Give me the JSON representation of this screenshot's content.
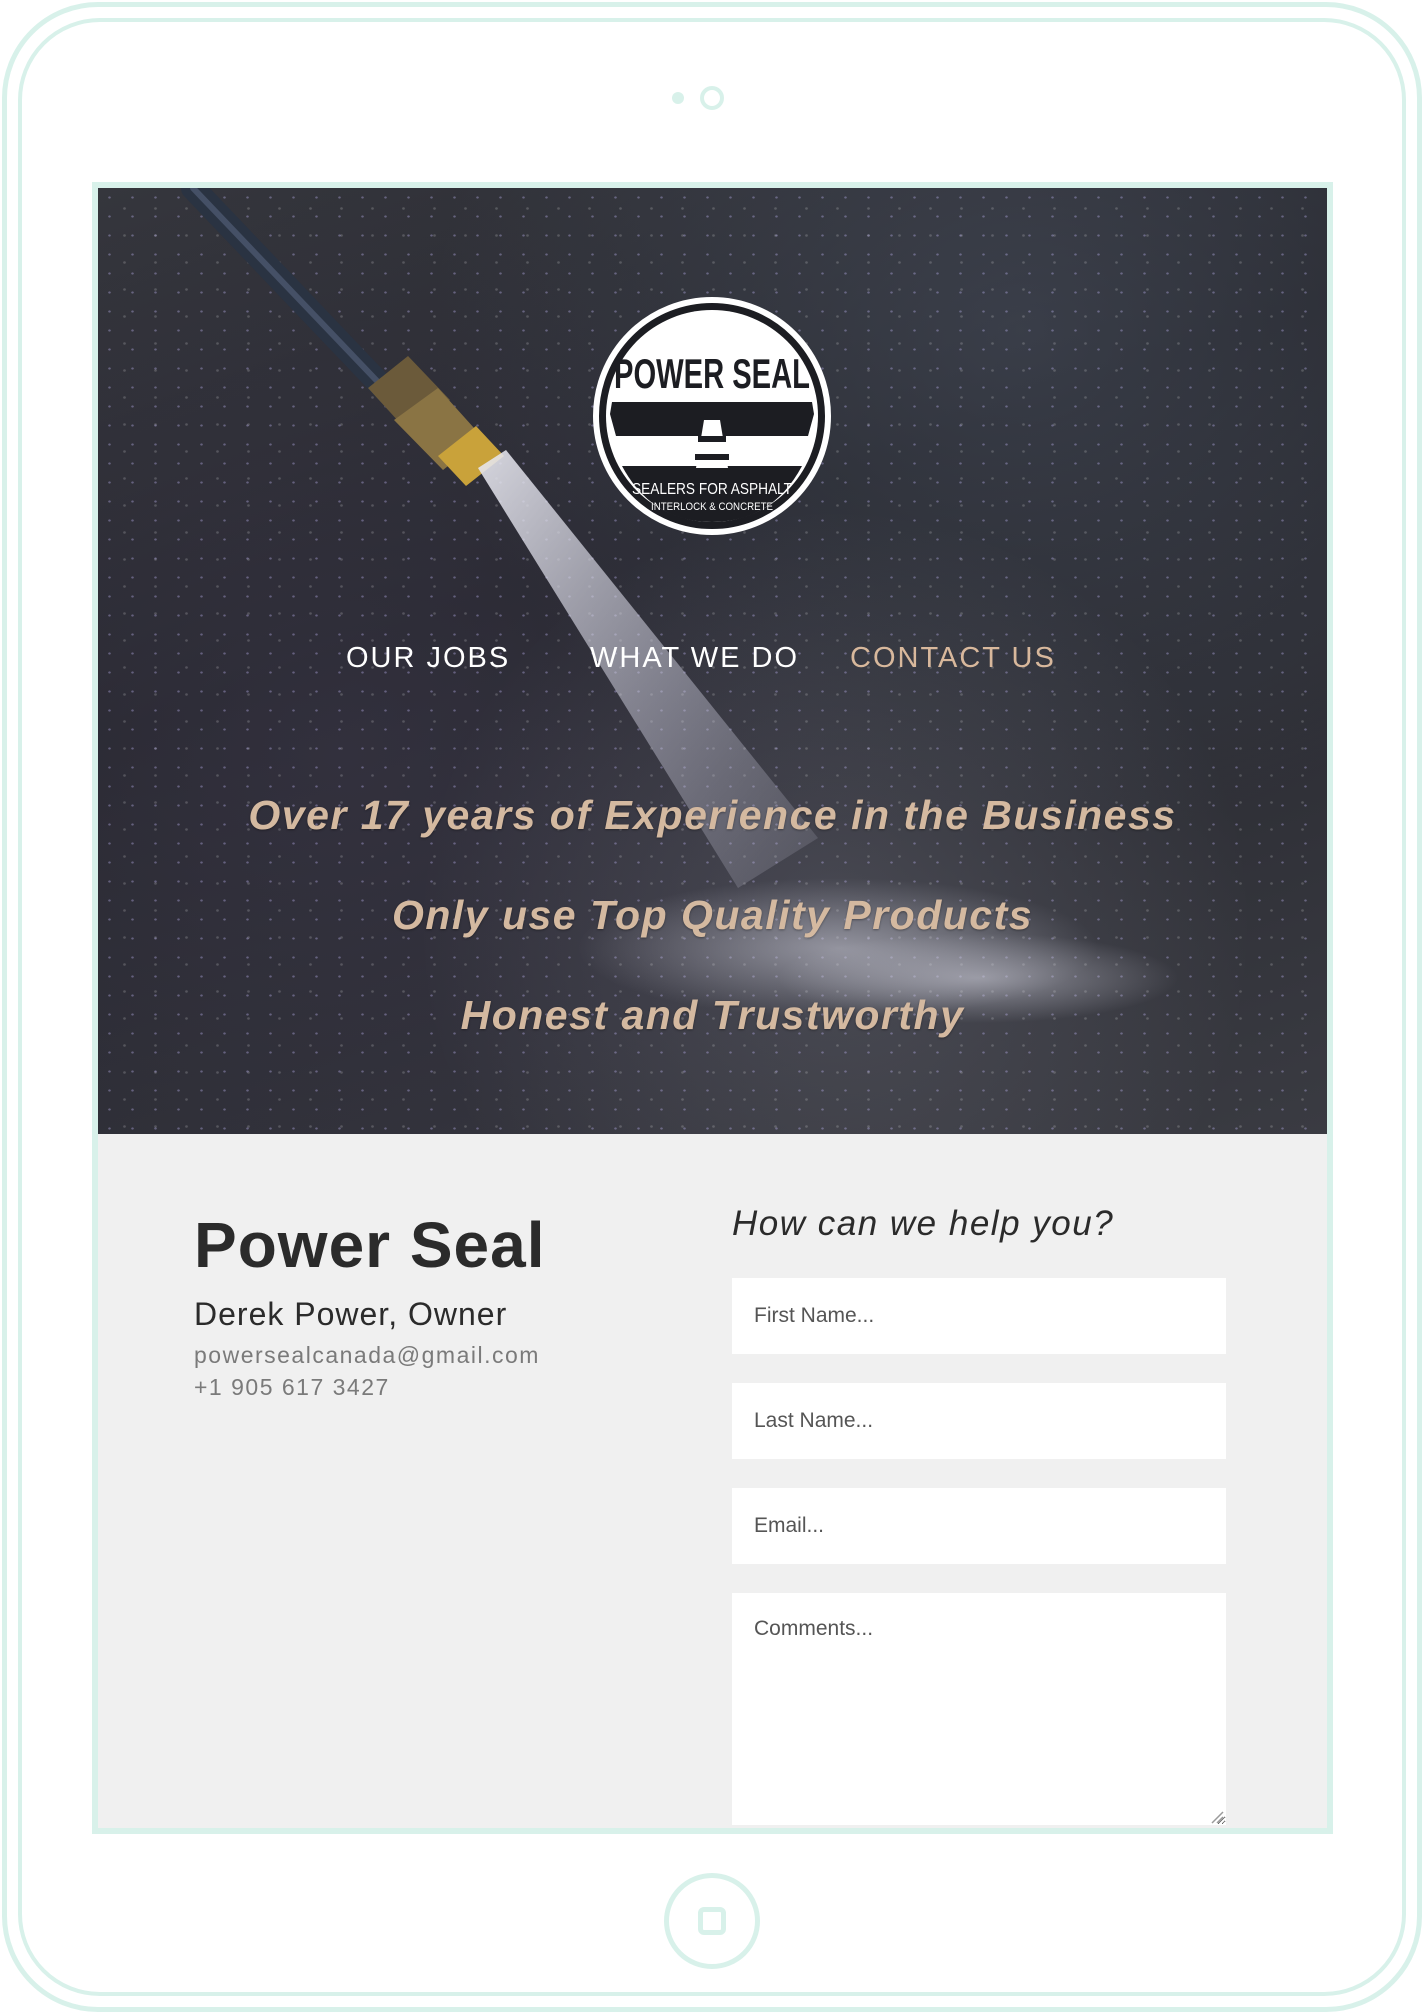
{
  "brand": {
    "logo_title": "POWER SEAL",
    "logo_subtitle": "SEALERS FOR ASPHALT",
    "logo_subtitle_small": "INTERLOCK & CONCRETE"
  },
  "nav": {
    "items": [
      {
        "label": "OUR JOBS",
        "active": false
      },
      {
        "label": "WHAT WE DO",
        "active": false
      },
      {
        "label": "CONTACT US",
        "active": true
      }
    ]
  },
  "hero": {
    "taglines": [
      "Over 17 years of Experience in the Business",
      "Only use Top Quality Products",
      "Honest and Trustworthy"
    ]
  },
  "contact": {
    "company": "Power Seal",
    "owner": "Derek Power, Owner",
    "email": "powersealcanada@gmail.com",
    "phone": "+1 905 617 3427"
  },
  "form": {
    "title": "How can we help you?",
    "first_name_placeholder": "First Name...",
    "last_name_placeholder": "Last Name...",
    "email_placeholder": "Email...",
    "comments_placeholder": "Comments..."
  },
  "colors": {
    "frame": "#d8f1ea",
    "nav_active": "#d8b89c",
    "tagline": "#d4b9a0",
    "section_bg": "#f0f0f0"
  }
}
